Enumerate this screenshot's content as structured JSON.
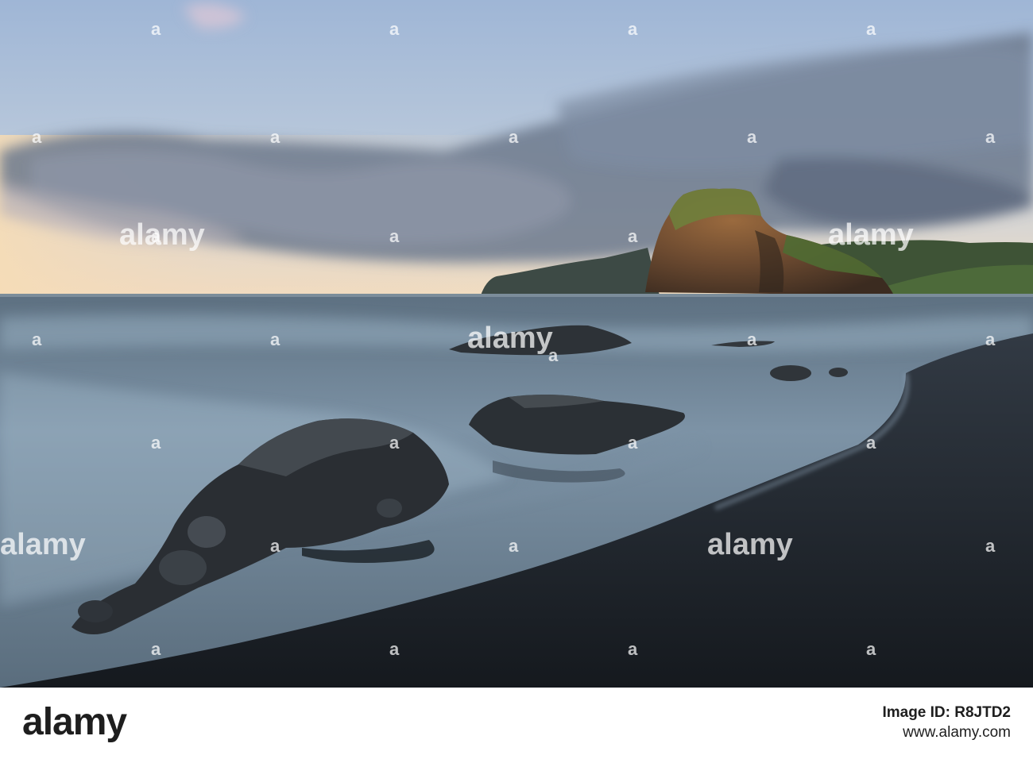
{
  "watermark": {
    "text": "alamy",
    "mark": "a"
  },
  "footer": {
    "logo": "alamy",
    "image_id": "Image ID: R8JTD2",
    "url": "www.alamy.com"
  },
  "colors": {
    "sky_top": "#a9bcd6",
    "sky_horizon": "#f2d6b0",
    "sea": "#6f8598",
    "sand": "#1f242b",
    "headland": "#6b4a30",
    "vegetation": "#5f7a3c"
  }
}
